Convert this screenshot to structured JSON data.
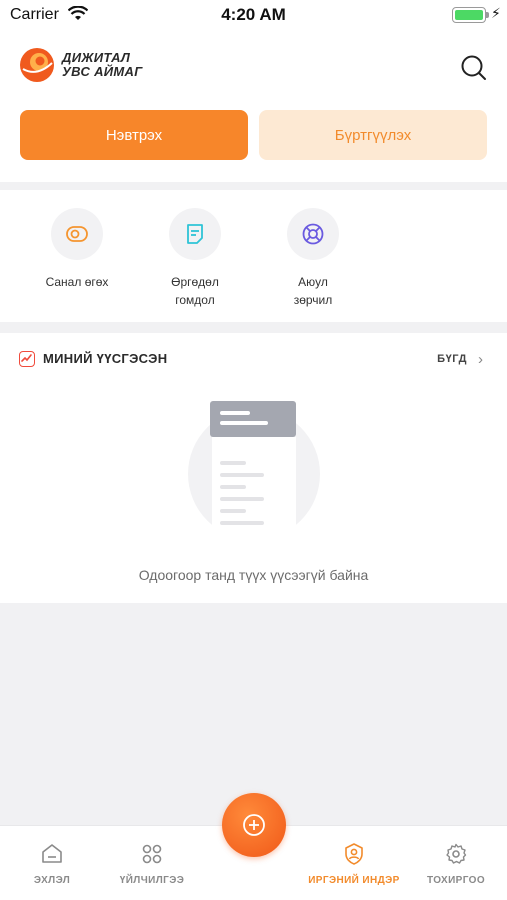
{
  "status_bar": {
    "carrier": "Carrier",
    "time": "4:20 AM"
  },
  "header": {
    "brand_line1": "ДИЖИТАЛ",
    "brand_line2": "УВС АЙМАГ"
  },
  "auth": {
    "login_label": "Нэвтрэх",
    "register_label": "Бүртгүүлэх"
  },
  "quick_actions": [
    {
      "label": "Санал өгөх",
      "icon": "eye-icon"
    },
    {
      "label": "Өргөдөл\nгомдол",
      "icon": "document-icon"
    },
    {
      "label": "Аюул\nзөрчил",
      "icon": "lifebuoy-icon"
    }
  ],
  "history": {
    "title": "МИНИЙ ҮҮСГЭСЭН",
    "all_label": "БҮГД",
    "empty_text": "Одоогоор танд түүх үүсээгүй байна"
  },
  "tabs": [
    {
      "label": "ЭХЛЭЛ",
      "icon": "home-icon",
      "active": false
    },
    {
      "label": "ҮЙЛЧИЛГЭЭ",
      "icon": "grid-icon",
      "active": false
    },
    {
      "label": "ИРГЭНИЙ ИНДЭР",
      "icon": "citizen-icon",
      "active": true
    },
    {
      "label": "ТОХИРГОО",
      "icon": "gear-icon",
      "active": false
    }
  ],
  "colors": {
    "accent": "#f7862a",
    "accent_light": "#fde9d3",
    "background": "#f1f1f3"
  }
}
